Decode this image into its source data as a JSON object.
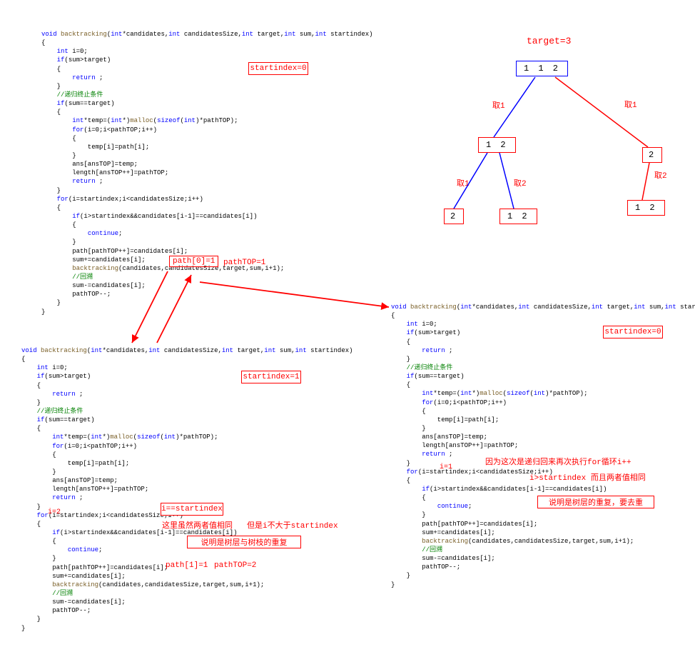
{
  "codeTop": "void backtracking(int*candidates,int candidatesSize,int target,int sum,int startindex)\n{\n    int i=0;\n    if(sum>target)\n    {\n        return ;\n    }\n    //递归终止条件\n    if(sum==target)\n    {\n        int*temp=(int*)malloc(sizeof(int)*pathTOP);\n        for(i=0;i<pathTOP;i++)\n        {\n            temp[i]=path[i];\n        }\n        ans[ansTOP]=temp;\n        length[ansTOP++]=pathTOP;\n        return ;\n    }\n    for(i=startindex;i<candidatesSize;i++)\n    {\n        if(i>startindex&&candidates[i-1]==candidates[i])\n        {\n            continue;\n        }\n        path[pathTOP++]=candidates[i];\n        sum+=candidates[i];\n        backtracking(candidates,candidatesSize,target,sum,i+1);\n        //回溯\n        sum-=candidates[i];\n        pathTOP--;\n    }\n}",
  "codeLeft": "void backtracking(int*candidates,int candidatesSize,int target,int sum,int startindex)\n{\n    int i=0;\n    if(sum>target)\n    {\n        return ;\n    }\n    //递归终止条件\n    if(sum==target)\n    {\n        int*temp=(int*)malloc(sizeof(int)*pathTOP);\n        for(i=0;i<pathTOP;i++)\n        {\n            temp[i]=path[i];\n        }\n        ans[ansTOP]=temp;\n        length[ansTOP++]=pathTOP;\n        return ;\n    }\n    for(i=startindex;i<candidatesSize;i++)\n    {\n        if(i>startindex&&candidates[i-1]==candidates[i])\n        {\n            continue;\n        }\n        path[pathTOP++]=candidates[i];\n        sum+=candidates[i];\n        backtracking(candidates,candidatesSize,target,sum,i+1);\n        //回溯\n        sum-=candidates[i];\n        pathTOP--;\n    }\n}",
  "codeRight": "void backtracking(int*candidates,int candidatesSize,int target,int sum,int startindex)\n{\n    int i=0;\n    if(sum>target)\n    {\n        return ;\n    }\n    //递归终止条件\n    if(sum==target)\n    {\n        int*temp=(int*)malloc(sizeof(int)*pathTOP);\n        for(i=0;i<pathTOP;i++)\n        {\n            temp[i]=path[i];\n        }\n        ans[ansTOP]=temp;\n        length[ansTOP++]=pathTOP;\n        return ;\n    }\n    for(i=startindex;i<candidatesSize;i++)\n    {\n        if(i>startindex&&candidates[i-1]==candidates[i])\n        {\n            continue;\n        }\n        path[pathTOP++]=candidates[i];\n        sum+=candidates[i];\n        backtracking(candidates,candidatesSize,target,sum,i+1);\n        //回溯\n        sum-=candidates[i];\n        pathTOP--;\n    }\n}",
  "annotations": {
    "startindex0a": "startindex=0",
    "startindex0b": "startindex=0",
    "startindex1": "startindex=1",
    "path01": "path[0]=1",
    "pathTOP1": "pathTOP=1",
    "path11": "path[1]=1",
    "pathTOP2": "pathTOP=2",
    "i2": "i=2",
    "i1": "i=1",
    "ieqstart": "i==startindex",
    "line_same": "这里虽然两者值相同",
    "line_not_gt": "但是i不大于startindex",
    "tree_branch_dup": "说明是树层与树枝的重复",
    "tree_layer_dup": "说明是树层的重复，要去重",
    "recursion_back": "因为这次是递归回来再次执行for循环i++",
    "i_gt_start": "i>startindex 而且两者值相同"
  },
  "tree": {
    "title": "target=3",
    "root": "1  1  2",
    "l1a": "1 2",
    "l1b": "2",
    "l2a": "2",
    "l2b": "1 2",
    "l2c": "1 2",
    "edge_take1": "取1",
    "edge_take2": "取2"
  }
}
